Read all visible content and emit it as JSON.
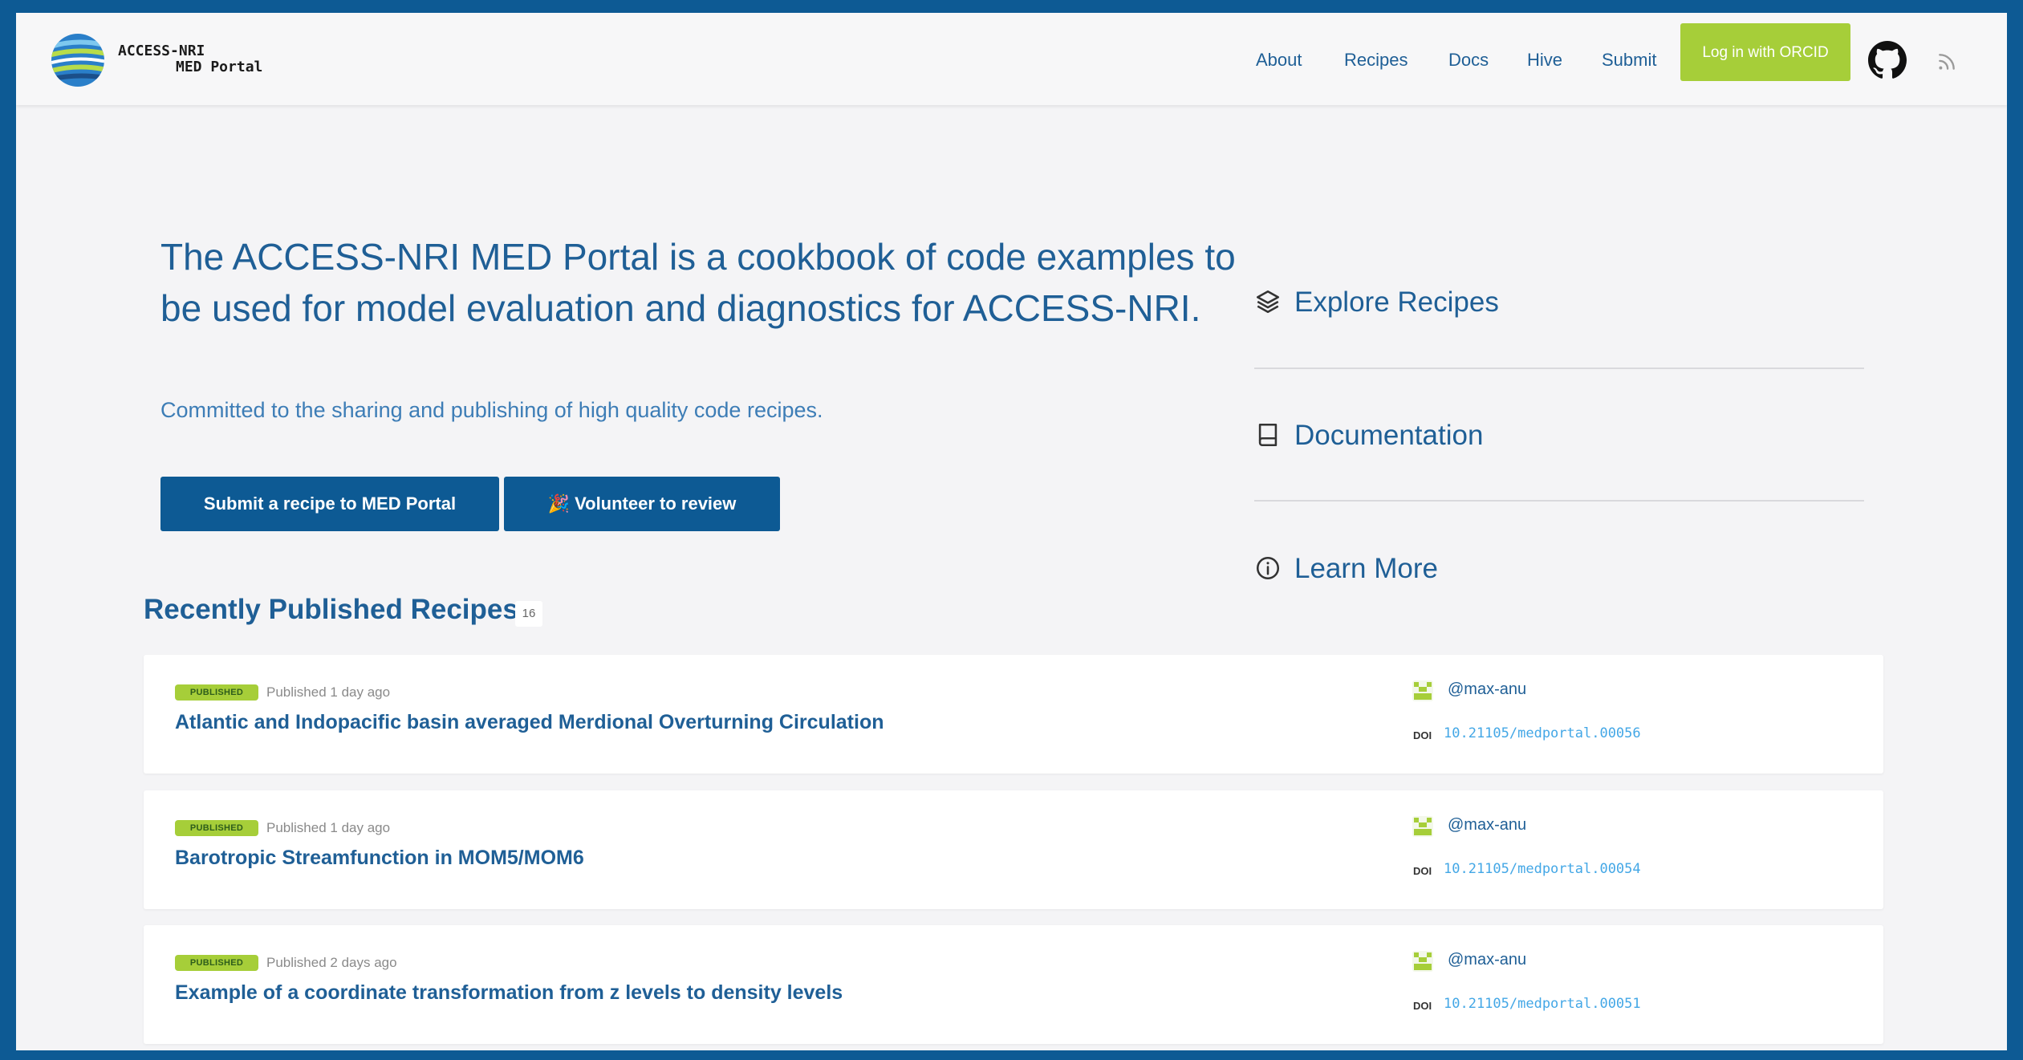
{
  "brand": {
    "line1": "ACCESS-NRI",
    "line2": "MED Portal"
  },
  "nav": {
    "items": [
      "About",
      "Recipes",
      "Docs",
      "Hive",
      "Submit"
    ],
    "login_label": "Log in with ORCID",
    "icons": [
      "github-icon",
      "rss-icon"
    ]
  },
  "hero": {
    "title": "The ACCESS-NRI MED Portal is a cookbook of code examples to be used for model evaluation and diagnostics for ACCESS-NRI.",
    "subtitle": "Committed to the sharing and publishing of high quality code recipes.",
    "submit_label": "Submit a recipe to MED Portal",
    "volunteer_label": "🎉 Volunteer to review"
  },
  "side_links": [
    {
      "label": "Explore Recipes",
      "icon": "layers-icon"
    },
    {
      "label": "Documentation",
      "icon": "book-icon"
    },
    {
      "label": "Learn More",
      "icon": "info-icon"
    }
  ],
  "recent": {
    "title": "Recently Published Recipes",
    "count": "16",
    "items": [
      {
        "badge": "PUBLISHED",
        "date": "Published 1 day ago",
        "title": "Atlantic and Indopacific basin averaged Merdional Overturning Circulation",
        "author": "@max-anu",
        "doi_label": "DOI",
        "doi": "10.21105/medportal.00056"
      },
      {
        "badge": "PUBLISHED",
        "date": "Published 1 day ago",
        "title": "Barotropic Streamfunction in MOM5/MOM6",
        "author": "@max-anu",
        "doi_label": "DOI",
        "doi": "10.21105/medportal.00054"
      },
      {
        "badge": "PUBLISHED",
        "date": "Published 2 days ago",
        "title": "Example of a coordinate transformation from z levels to density levels",
        "author": "@max-anu",
        "doi_label": "DOI",
        "doi": "10.21105/medportal.00051"
      }
    ]
  },
  "colors": {
    "brand_blue": "#0d5a94",
    "link_blue": "#1f5f96",
    "orcid_green": "#a6ce39",
    "doi_blue": "#43a7e6"
  }
}
